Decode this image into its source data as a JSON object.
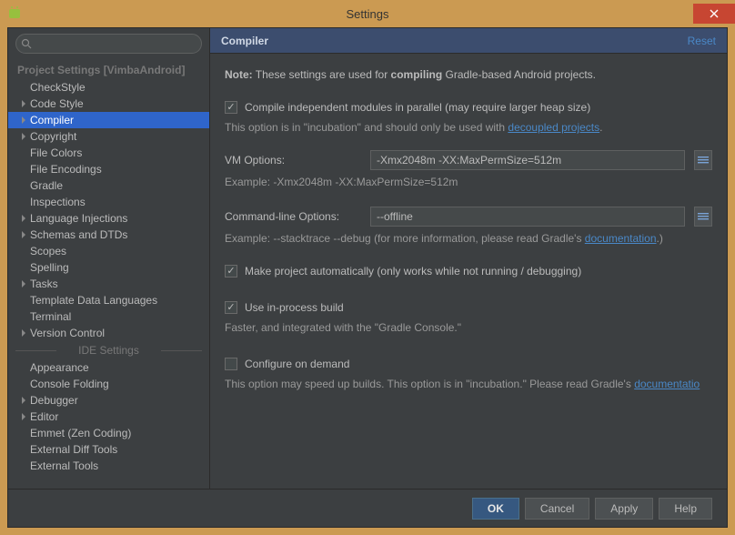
{
  "title": "Settings",
  "sidebar": {
    "project_header": "Project Settings [VimbaAndroid]",
    "ide_header": "IDE Settings",
    "items": [
      {
        "label": "CheckStyle",
        "arrow": false
      },
      {
        "label": "Code Style",
        "arrow": true
      },
      {
        "label": "Compiler",
        "arrow": true,
        "selected": true
      },
      {
        "label": "Copyright",
        "arrow": true
      },
      {
        "label": "File Colors",
        "arrow": false
      },
      {
        "label": "File Encodings",
        "arrow": false
      },
      {
        "label": "Gradle",
        "arrow": false
      },
      {
        "label": "Inspections",
        "arrow": false
      },
      {
        "label": "Language Injections",
        "arrow": true
      },
      {
        "label": "Schemas and DTDs",
        "arrow": true
      },
      {
        "label": "Scopes",
        "arrow": false
      },
      {
        "label": "Spelling",
        "arrow": false
      },
      {
        "label": "Tasks",
        "arrow": true
      },
      {
        "label": "Template Data Languages",
        "arrow": false
      },
      {
        "label": "Terminal",
        "arrow": false
      },
      {
        "label": "Version Control",
        "arrow": true
      }
    ],
    "ide_items": [
      {
        "label": "Appearance",
        "arrow": false
      },
      {
        "label": "Console Folding",
        "arrow": false
      },
      {
        "label": "Debugger",
        "arrow": true
      },
      {
        "label": "Editor",
        "arrow": true
      },
      {
        "label": "Emmet (Zen Coding)",
        "arrow": false
      },
      {
        "label": "External Diff Tools",
        "arrow": false
      },
      {
        "label": "External Tools",
        "arrow": false
      }
    ]
  },
  "header": {
    "title": "Compiler",
    "reset": "Reset"
  },
  "panel": {
    "note_bold": "Note:",
    "note_pre": " These settings are used for ",
    "note_emph": "compiling",
    "note_post": " Gradle-based Android projects.",
    "cb1_label": "Compile independent modules in parallel (may require larger heap size)",
    "cb1_hint_pre": "This option is in \"incubation\" and should only be used with ",
    "cb1_link": "decoupled projects",
    "cb1_hint_post": ".",
    "vm_label": "VM Options:",
    "vm_value": "-Xmx2048m -XX:MaxPermSize=512m",
    "vm_example": "Example: -Xmx2048m -XX:MaxPermSize=512m",
    "cli_label": "Command-line Options:",
    "cli_value": "--offline",
    "cli_example_pre": "Example: --stacktrace --debug (for more information, please read Gradle's ",
    "cli_link": "documentation",
    "cli_example_post": ".)",
    "cb2_label": "Make project automatically (only works while not running / debugging)",
    "cb3_label": "Use in-process build",
    "cb3_hint": "Faster, and integrated with the \"Gradle Console.\"",
    "cb4_label": "Configure on demand",
    "cb4_hint_pre": "This option may speed up builds. This option is in \"incubation.\" Please read Gradle's ",
    "cb4_link": "documentatio"
  },
  "footer": {
    "ok": "OK",
    "cancel": "Cancel",
    "apply": "Apply",
    "help": "Help"
  }
}
